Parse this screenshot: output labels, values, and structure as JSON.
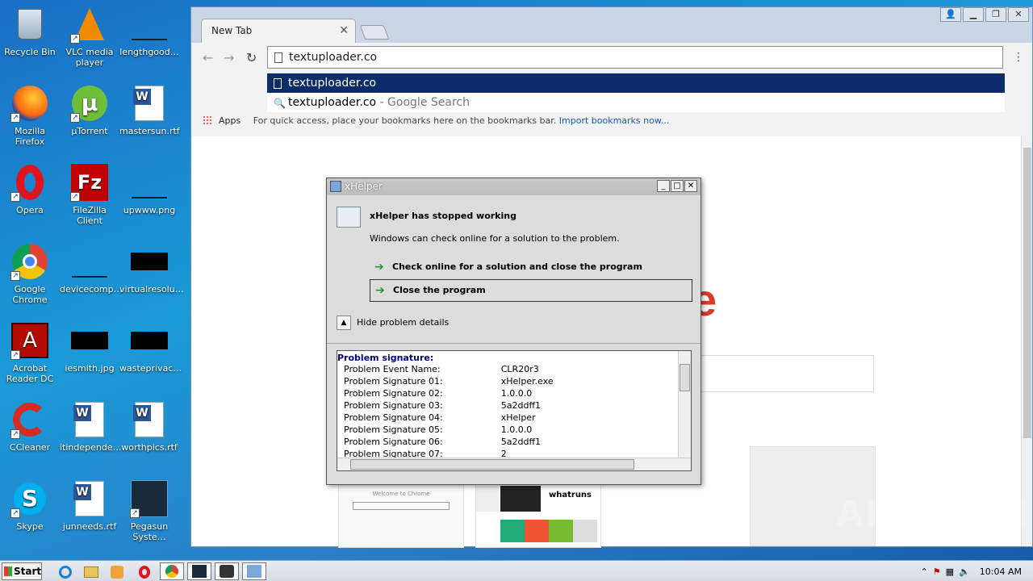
{
  "desktop": {
    "icons": [
      {
        "label": "Recycle Bin",
        "icon": "recycle-bin-icon"
      },
      {
        "label": "VLC media player",
        "icon": "vlc-icon"
      },
      {
        "label": "lengthgood…",
        "icon": "file-icon"
      },
      {
        "label": "Mozilla Firefox",
        "icon": "firefox-icon"
      },
      {
        "label": "µTorrent",
        "icon": "utorrent-icon"
      },
      {
        "label": "mastersun.rtf",
        "icon": "word-doc-icon"
      },
      {
        "label": "Opera",
        "icon": "opera-icon"
      },
      {
        "label": "FileZilla Client",
        "icon": "filezilla-icon"
      },
      {
        "label": "upwww.png",
        "icon": "image-file-icon"
      },
      {
        "label": "Google Chrome",
        "icon": "chrome-icon"
      },
      {
        "label": "devicecomp…",
        "icon": "file-icon"
      },
      {
        "label": "virtualresolu…",
        "icon": "image-file-icon"
      },
      {
        "label": "Acrobat Reader DC",
        "icon": "acrobat-icon"
      },
      {
        "label": "iesmith.jpg",
        "icon": "image-file-icon"
      },
      {
        "label": "wasteprivac…",
        "icon": "image-file-icon"
      },
      {
        "label": "CCleaner",
        "icon": "ccleaner-icon"
      },
      {
        "label": "itindepende…",
        "icon": "word-doc-icon"
      },
      {
        "label": "worthpics.rtf",
        "icon": "word-doc-icon"
      },
      {
        "label": "Skype",
        "icon": "skype-icon"
      },
      {
        "label": "junneeds.rtf",
        "icon": "word-doc-icon"
      },
      {
        "label": "Pegasun Syste…",
        "icon": "pegasun-icon"
      }
    ]
  },
  "browser": {
    "tab_title": "New Tab",
    "address": "textuploader.co",
    "suggestions": [
      {
        "text": "textuploader.co",
        "suffix": ""
      },
      {
        "text": "textuploader.co",
        "suffix": " - Google Search"
      }
    ],
    "bookmarks": {
      "apps": "Apps",
      "hint": "For quick access, place your bookmarks here on the bookmarks bar.",
      "import_link": "Import bookmarks now..."
    },
    "thumb_whatruns": "whatruns",
    "thumb_welcome": "Welcome to Chrome"
  },
  "dialog": {
    "title": "xHelper",
    "heading": "xHelper has stopped working",
    "subtext": "Windows can check online for a solution to the problem.",
    "option1": "Check online for a solution and close the program",
    "option2": "Close the program",
    "details_toggle": "Hide problem details",
    "details_header": "Problem signature:",
    "details": [
      {
        "k": "Problem Event Name:",
        "v": "CLR20r3"
      },
      {
        "k": "Problem Signature 01:",
        "v": "xHelper.exe"
      },
      {
        "k": "Problem Signature 02:",
        "v": "1.0.0.0"
      },
      {
        "k": "Problem Signature 03:",
        "v": "5a2ddff1"
      },
      {
        "k": "Problem Signature 04:",
        "v": "xHelper"
      },
      {
        "k": "Problem Signature 05:",
        "v": "1.0.0.0"
      },
      {
        "k": "Problem Signature 06:",
        "v": "5a2ddff1"
      },
      {
        "k": "Problem Signature 07:",
        "v": "2"
      }
    ]
  },
  "taskbar": {
    "start": "Start",
    "clock": "10:04 AM"
  },
  "watermark": "ANY RUN"
}
